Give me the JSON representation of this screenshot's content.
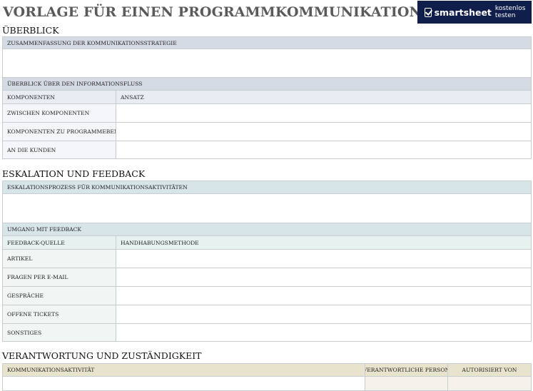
{
  "page": {
    "title": "VORLAGE FÜR EINEN PROGRAMMKOMMUNIKATIONSPLAN"
  },
  "logo": {
    "brand": "smartsheet",
    "cta": "kostenlos testen"
  },
  "overview": {
    "heading": "ÜBERBLICK",
    "summary_label": "ZUSAMMENFASSUNG DER KOMMUNIKATIONSSTRATEGIE",
    "flow_label": "ÜBERBLICK ÜBER DEN INFORMATIONSFLUSS",
    "col_components": "KOMPONENTEN",
    "col_approach": "ANSATZ",
    "rows": [
      "ZWISCHEN KOMPONENTEN",
      "KOMPONENTEN ZU PROGRAMMEBENE",
      "AN DIE KUNDEN"
    ]
  },
  "escalation": {
    "heading": "ESKALATION UND FEEDBACK",
    "process_label": "ESKALATIONSPROZESS FÜR KOMMUNIKATIONSAKTIVITÄTEN",
    "feedback_label": "UMGANG MIT FEEDBACK",
    "col_source": "FEEDBACK-QUELLE",
    "col_method": "HANDHABUNGSMETHODE",
    "rows": [
      "ARTIKEL",
      "FRAGEN PER E-MAIL",
      "GESPRÄCHE",
      "OFFENE TICKETS",
      "SONSTIGES"
    ]
  },
  "responsibility": {
    "heading": "VERANTWORTUNG UND ZUSTÄNDIGKEIT",
    "col_activity": "KOMMUNIKATIONSAKTIVITÄT",
    "col_person": "VERANTWORTLICHE PERSON",
    "col_authorized": "AUTORISIERT VON"
  },
  "colors": {
    "title": "#5a5a5a",
    "logo_bg": "#0f1e4a",
    "overview_band": "#d5dbe4",
    "escalation_band": "#d7e4e8",
    "responsibility_head": "#e8e3cc"
  }
}
